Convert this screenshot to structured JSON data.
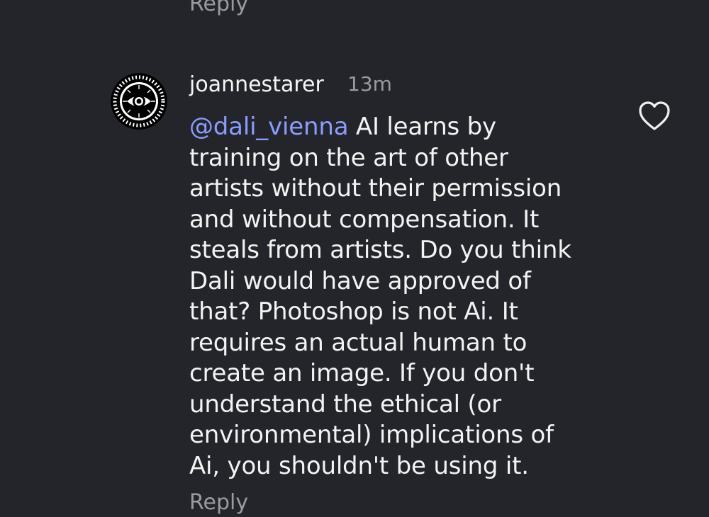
{
  "previous_comment": {
    "reply_label": "Reply"
  },
  "comment": {
    "username": "joannestarer",
    "time_ago": "13m",
    "mention": "@dali_vienna",
    "mention_icon": "threads-icon",
    "lines": [
      " AI learns by",
      "training on the art of other",
      "artists without their permission",
      "and without compensation. It",
      "steals from artists. Do you think",
      "Dali would have approved of",
      "that? Photoshop is not Ai. It",
      "requires an actual human to",
      "create an image. If you don't",
      "understand the ethical (or",
      "environmental) implications of",
      "Ai, you shouldn't be using it."
    ],
    "like_icon": "heart-icon",
    "reply_label": "Reply"
  },
  "colors": {
    "background": "#24252a",
    "text": "#f3f3f3",
    "muted": "#9a9ba0",
    "mention": "#8b9cff"
  }
}
